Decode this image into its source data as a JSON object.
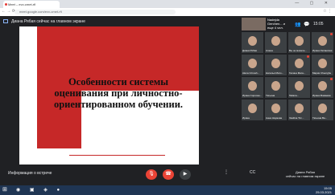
{
  "browser": {
    "tab_title": "Meet – evv-cmet-rfi",
    "url": "meet.google.com/evv-cmet-rfi",
    "window_controls": "— ▢ ✕"
  },
  "presentation_banner": "Диана Рябая сейчас на главном экране",
  "slide": {
    "title": "Особенности системы оценивания при личностно-ориентированном обучении."
  },
  "top_right": {
    "pinned_name": "Nadejda Gerchen... и еще 4 чел.",
    "people_icon": "people-icon",
    "chat_icon": "chat-icon",
    "time": "15:05"
  },
  "participants": [
    {
      "name": "Диана Рябая"
    },
    {
      "name": "Алена"
    },
    {
      "name": "Вы не можете..."
    },
    {
      "name": "Ирина Оксанская"
    },
    {
      "name": "Alena Crivosh..."
    },
    {
      "name": "Наталья Мато..."
    },
    {
      "name": "Галина Мата..."
    },
    {
      "name": "Мария Cheorghe"
    },
    {
      "name": "Ирина Сорочан..."
    },
    {
      "name": "Татьяна"
    },
    {
      "name": "Tatiana..."
    },
    {
      "name": "Ирина Мамаева"
    },
    {
      "name": "Ирина"
    },
    {
      "name": "Анна Наумова"
    },
    {
      "name": "Vasilina Tim..."
    },
    {
      "name": "Татьяна Ва..."
    }
  ],
  "bottom_bar": {
    "meeting_info": "Информация о встрече",
    "presenter_line1": "Диана Рябая",
    "presenter_line2": "сейчас на главном экране"
  },
  "taskbar": {
    "time": "15:05",
    "date": "25.03.2021"
  },
  "colors": {
    "end_call": "#ea4335",
    "slide_red": "#c62828"
  }
}
